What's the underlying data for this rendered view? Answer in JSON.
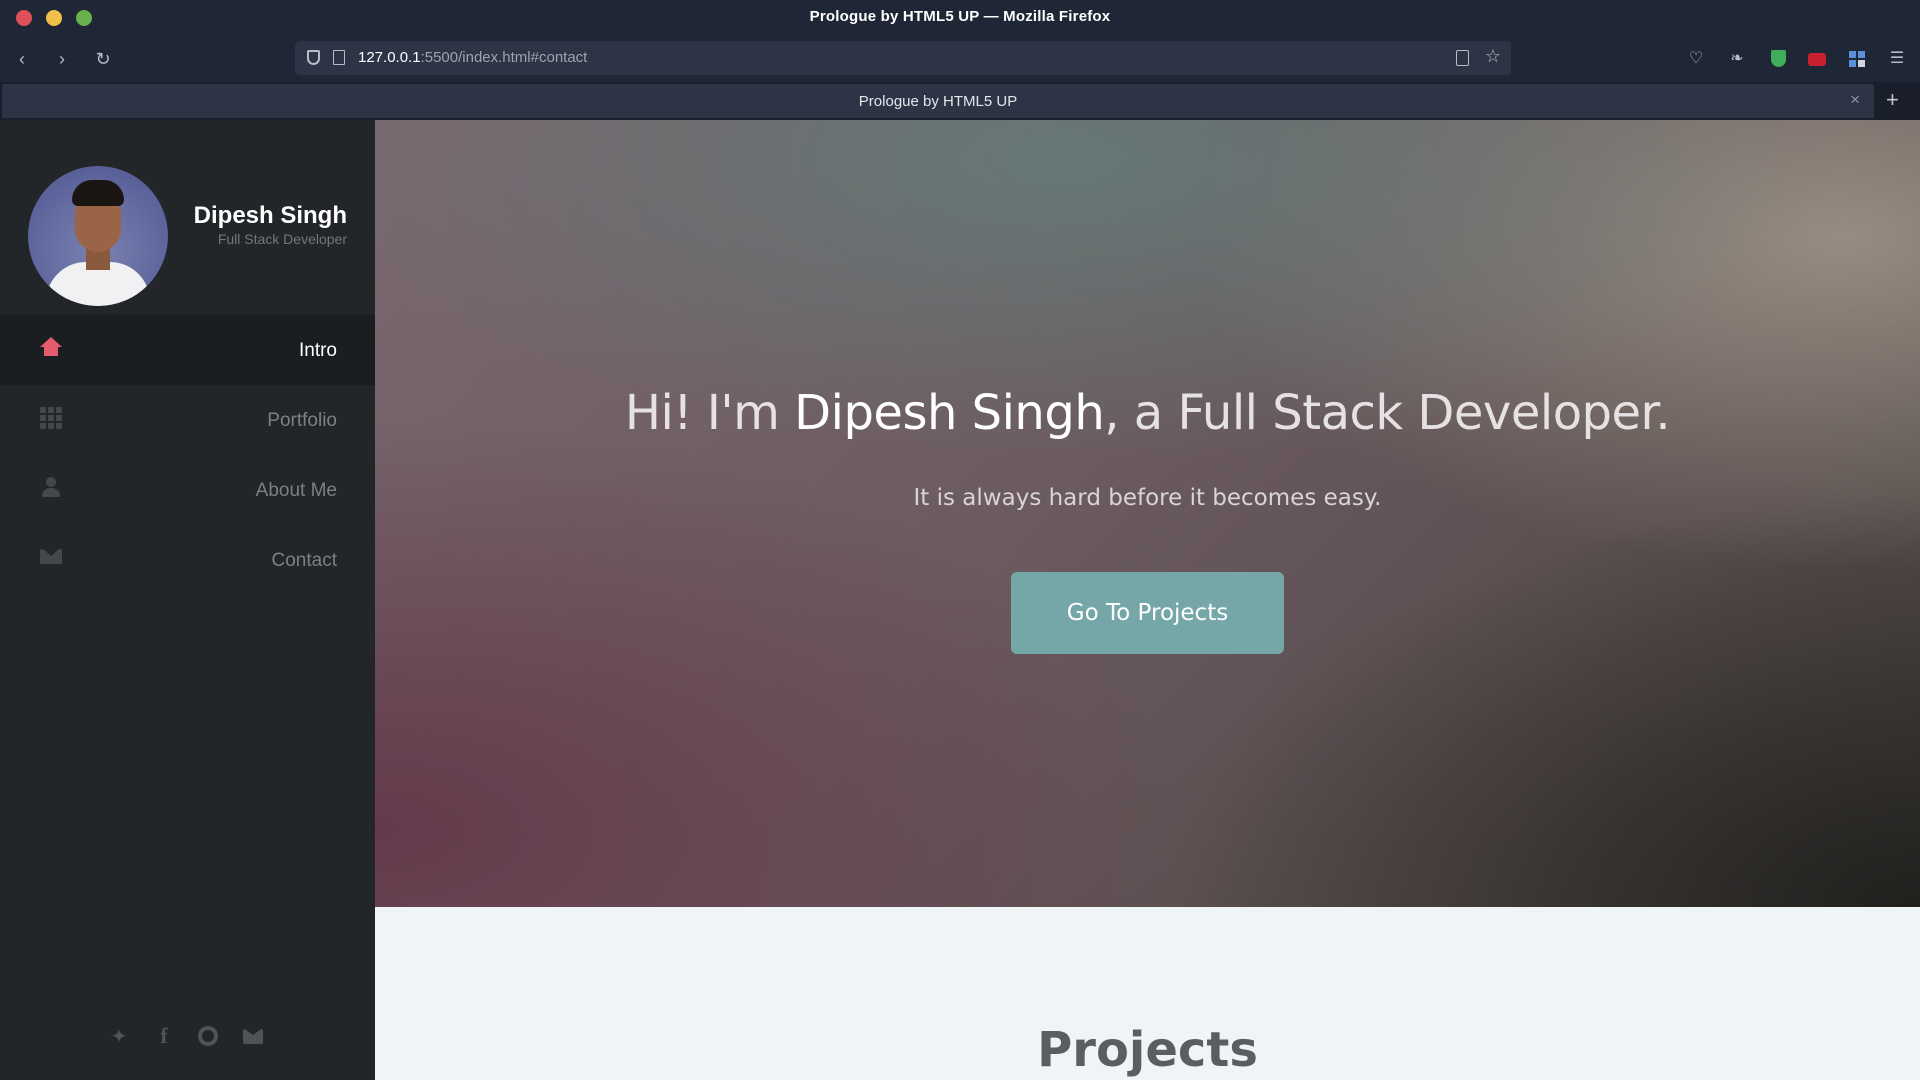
{
  "window": {
    "title": "Prologue by HTML5 UP — Mozilla Firefox"
  },
  "browser": {
    "url_host": "127.0.0.1",
    "url_rest": ":5500/index.html#contact",
    "tab_title": "Prologue by HTML5 UP",
    "toolbar_icons": [
      "back-icon",
      "forward-icon",
      "reload-icon",
      "shield-icon",
      "page-icon",
      "reader-view-icon",
      "bookmark-star-icon",
      "pocket-icon",
      "extension-icon",
      "shield-extension-icon",
      "red-extension-icon",
      "grid-extension-icon",
      "menu-icon"
    ]
  },
  "profile": {
    "name": "Dipesh Singh",
    "role": "Full Stack Developer"
  },
  "nav": {
    "items": [
      {
        "label": "Intro",
        "icon": "home-icon",
        "active": true
      },
      {
        "label": "Portfolio",
        "icon": "grid-icon",
        "active": false
      },
      {
        "label": "About Me",
        "icon": "user-icon",
        "active": false
      },
      {
        "label": "Contact",
        "icon": "envelope-icon",
        "active": false
      }
    ]
  },
  "social": [
    "twitter-icon",
    "facebook-icon",
    "github-icon",
    "envelope-icon"
  ],
  "hero": {
    "title_pre": "Hi! I'm ",
    "title_name": "Dipesh Singh",
    "title_post": ", a Full Stack Developer.",
    "subtitle": "It is always hard before it becomes easy.",
    "button_label": "Go To Projects"
  },
  "projects": {
    "title": "Projects"
  },
  "colors": {
    "accent_home_icon": "#e35b6d",
    "button": "#76a7a8",
    "sidebar": "#222629",
    "browser_chrome": "#1f2636"
  }
}
